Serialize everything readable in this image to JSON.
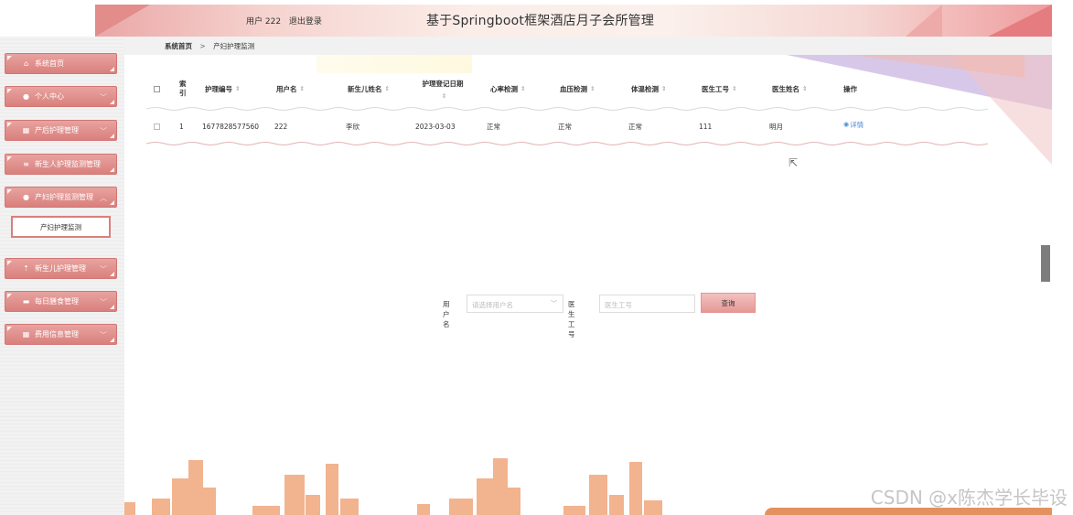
{
  "header": {
    "user_label": "用户 222",
    "logout_label": "退出登录",
    "title": "基于Springboot框架酒店月子会所管理"
  },
  "breadcrumb": {
    "home": "系统首页",
    "separator": ">",
    "current": "产妇护理监测"
  },
  "sidebar": {
    "items": [
      {
        "label": "系统首页",
        "icon": "home-icon"
      },
      {
        "label": "个人中心",
        "icon": "person-icon"
      },
      {
        "label": "产后护理管理",
        "icon": "grid-icon"
      },
      {
        "label": "新生人护理监测管理",
        "icon": "list-icon"
      },
      {
        "label": "产妇护理监测管理",
        "icon": "location-icon"
      },
      {
        "label": "新生儿护理管理",
        "icon": "upload-icon"
      },
      {
        "label": "每日膳食管理",
        "icon": "monitor-icon"
      },
      {
        "label": "费用信息管理",
        "icon": "grid-icon"
      }
    ],
    "submenu_active": "产妇护理监测"
  },
  "table": {
    "headers": {
      "index": "索引",
      "nursing_no": "护理编号",
      "username": "用户名",
      "baby_name": "新生儿姓名",
      "register_date": "护理登记日期",
      "heart_rate": "心率检测",
      "blood_pressure": "血压检测",
      "temperature": "体温检测",
      "doctor_no": "医生工号",
      "doctor_name": "医生姓名",
      "action": "操作"
    },
    "rows": [
      {
        "index": "1",
        "nursing_no": "1677828577560",
        "username": "222",
        "baby_name": "李欣",
        "register_date": "2023-03-03",
        "heart_rate": "正常",
        "blood_pressure": "正常",
        "temperature": "正常",
        "doctor_no": "111",
        "doctor_name": "明月",
        "action": "详情"
      }
    ]
  },
  "search": {
    "username_label": "用户名",
    "username_placeholder": "请选择用户名",
    "doctor_no_label": "医生工号",
    "doctor_no_placeholder": "医生工号",
    "button": "查询"
  },
  "watermark": "CSDN @x陈杰学长毕设",
  "colors": {
    "accent": "#d9807d",
    "link": "#4a8ad6",
    "skyline": "#f2b38f"
  }
}
